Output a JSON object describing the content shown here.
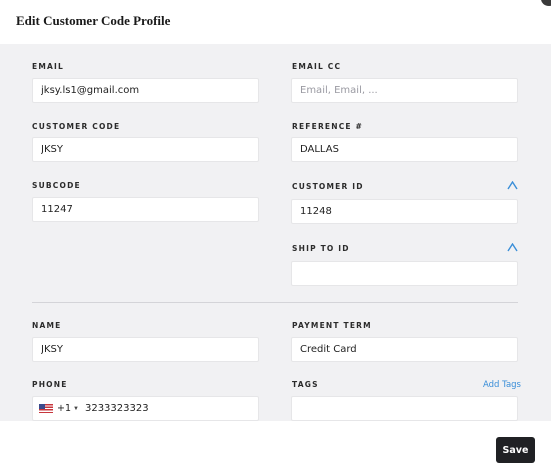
{
  "dialog": {
    "title": "Edit Customer Code Profile"
  },
  "form": {
    "email": {
      "label": "EMAIL",
      "value": "jksy.ls1@gmail.com"
    },
    "email_cc": {
      "label": "EMAIL CC",
      "placeholder": "Email, Email, ..."
    },
    "customer_code": {
      "label": "CUSTOMER CODE",
      "value": "JKSY"
    },
    "reference": {
      "label": "REFERENCE #",
      "value": "DALLAS"
    },
    "subcode": {
      "label": "SUBCODE",
      "value": "11247"
    },
    "customer_id": {
      "label": "CUSTOMER ID",
      "value": "11248"
    },
    "ship_to_id": {
      "label": "SHIP TO ID",
      "value": ""
    },
    "name": {
      "label": "NAME",
      "value": "JKSY"
    },
    "payment_term": {
      "label": "PAYMENT TERM",
      "value": "Credit Card"
    },
    "phone": {
      "label": "PHONE",
      "dial_code": "+1",
      "value": "3233323323"
    },
    "tags": {
      "label": "TAGS",
      "add_label": "Add Tags",
      "value": ""
    }
  },
  "footer": {
    "save_label": "Save"
  },
  "colors": {
    "accent": "#3a8ed8",
    "save_bg": "#202124",
    "body_bg": "#f1f1f3"
  },
  "icons": {
    "field_caret": "caret-up-icon",
    "flag": "us-flag-icon",
    "dial_dropdown": "caret-down-icon"
  }
}
